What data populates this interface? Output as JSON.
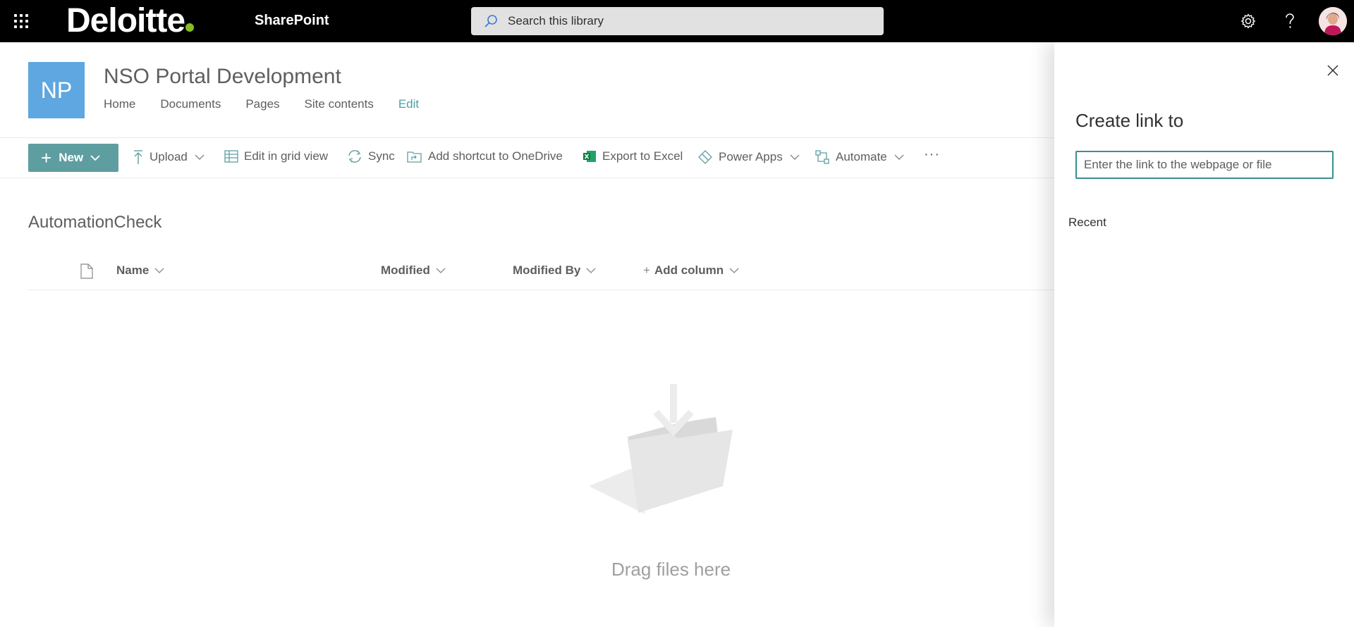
{
  "suitebar": {
    "brand": "Deloitte",
    "app_name": "SharePoint",
    "search_placeholder": "Search this library",
    "brand_dot_color": "#86bc25"
  },
  "site": {
    "logo_initials": "NP",
    "title": "NSO Portal Development",
    "nav": [
      "Home",
      "Documents",
      "Pages",
      "Site contents",
      "Edit"
    ]
  },
  "commandbar": {
    "new_label": "New",
    "upload": "Upload",
    "grid_view": "Edit in grid view",
    "sync": "Sync",
    "shortcut": "Add shortcut to OneDrive",
    "export": "Export to Excel",
    "power_apps": "Power Apps",
    "automate": "Automate",
    "more": "···"
  },
  "library": {
    "title": "AutomationCheck",
    "columns": [
      "Name",
      "Modified",
      "Modified By",
      "Add column"
    ],
    "empty_text": "Drag files here"
  },
  "panel": {
    "title": "Create link to",
    "input_placeholder": "Enter the link to the webpage or file",
    "recent_label": "Recent"
  },
  "colors": {
    "accent": "#5f9ea0",
    "site_logo": "#5ea7e0"
  }
}
